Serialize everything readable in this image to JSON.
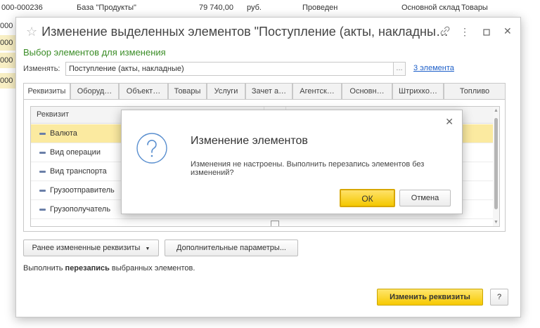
{
  "background": {
    "top_row": {
      "number": "000-000236",
      "base": "База \"Продукты\"",
      "amount": "79 740,00",
      "currency": "руб.",
      "status": "Проведен",
      "warehouse": "Основной склад",
      "goods": "Товары"
    },
    "left_fragments": [
      "000",
      "000",
      "000",
      "000",
      "000"
    ]
  },
  "dialog": {
    "title": "Изменение выделенных элементов \"Поступление (акты, накладны…",
    "subtitle": "Выбор элементов для изменения",
    "change_label": "Изменять:",
    "change_value": "Поступление (акты, накладные)",
    "select_button": "...",
    "elements_link": "3 элемента",
    "tabs": [
      "Реквизиты",
      "Оборуд…",
      "Объект…",
      "Товары",
      "Услуги",
      "Зачет а…",
      "Агентск…",
      "Основн…",
      "Штрихко…",
      "Топливо"
    ],
    "grid": {
      "header": "Реквизит",
      "rows": [
        {
          "label": "Валюта",
          "selected": true
        },
        {
          "label": "Вид операции",
          "selected": false
        },
        {
          "label": "Вид транспорта",
          "selected": false
        },
        {
          "label": "Грузоотправитель",
          "selected": false
        },
        {
          "label": "Грузополучатель",
          "selected": false
        },
        {
          "label": "",
          "selected": false
        }
      ]
    },
    "prev_changed_button": "Ранее измененные реквизиты",
    "extra_params_button": "Дополнительные параметры...",
    "hint_prefix": "Выполнить ",
    "hint_bold": "перезапись",
    "hint_suffix": " выбранных элементов.",
    "apply_button": "Изменить реквизиты",
    "help_button": "?"
  },
  "modal": {
    "title": "Изменение элементов",
    "text": "Изменения не настроены. Выполнить перезапись элементов без изменений?",
    "ok": "ОК",
    "cancel": "Отмена"
  },
  "icons": {
    "star": "star-icon",
    "link": "link-icon",
    "more": "more-icon",
    "maximize": "maximize-icon",
    "close": "close-icon",
    "question": "question-icon"
  },
  "colors": {
    "accent_yellow": "#f7c900",
    "subtitle_green": "#3a8c26",
    "link_blue": "#1d5fc9",
    "selected_row": "#fbeaa0"
  }
}
